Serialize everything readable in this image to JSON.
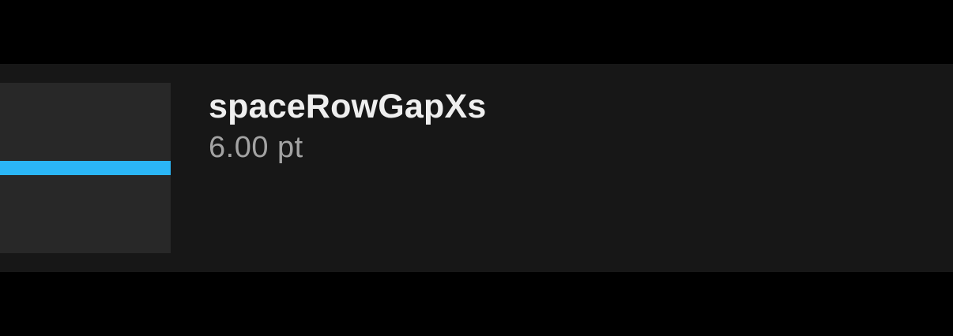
{
  "token": {
    "name": "spaceRowGapXs",
    "value": "6.00 pt"
  },
  "colors": {
    "background": "#000000",
    "card": "#171717",
    "swatch": "#282828",
    "accent": "#2bb6f6",
    "name_text": "#efefef",
    "value_text": "#a3a3a3"
  }
}
